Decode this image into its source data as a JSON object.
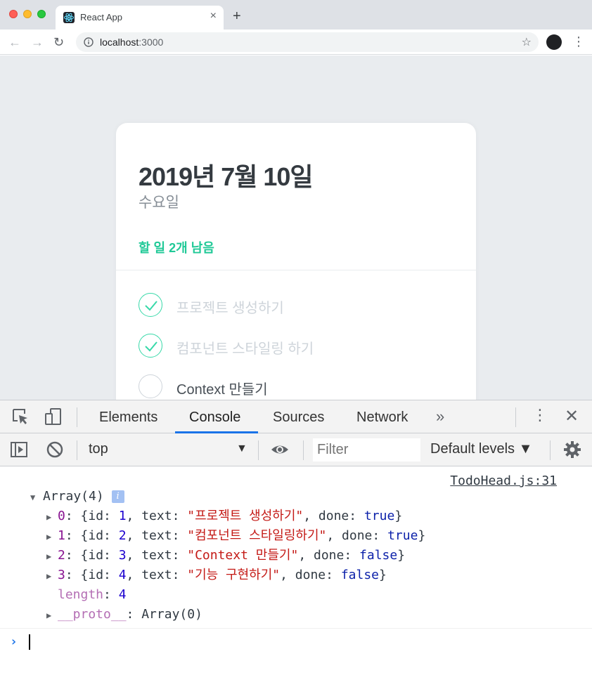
{
  "browser": {
    "tab_title": "React App",
    "tab_close": "×",
    "new_tab": "+",
    "url_host": "localhost",
    "url_port": ":3000",
    "back_icon": "←",
    "forward_icon": "→",
    "reload_icon": "↻",
    "star_icon": "☆",
    "menu_icon": "⋮"
  },
  "todo": {
    "date": "2019년 7월 10일",
    "day": "수요일",
    "tasks_left": "할 일 2개 남음",
    "items": [
      {
        "text": "프로젝트 생성하기",
        "done": true
      },
      {
        "text": "컴포넌트 스타일링 하기",
        "done": true
      },
      {
        "text": "Context 만들기",
        "done": false
      }
    ],
    "accent_color": "#20c997"
  },
  "devtools": {
    "tabs": [
      "Elements",
      "Console",
      "Sources",
      "Network"
    ],
    "active_tab": "Console",
    "more_tabs": "»",
    "kebab": "⋮",
    "close": "✕",
    "context": "top",
    "context_arrow": "▼",
    "filter_placeholder": "Filter",
    "levels": "Default levels ▼",
    "console": {
      "source": "TodoHead.js:31",
      "array_label": "Array(4)",
      "info": "i",
      "rows": [
        {
          "index": "0",
          "id": "1",
          "text": "\"프로젝트 생성하기\"",
          "done": "true"
        },
        {
          "index": "1",
          "id": "2",
          "text": "\"컴포넌트 스타일링하기\"",
          "done": "true"
        },
        {
          "index": "2",
          "id": "3",
          "text": "\"Context 만들기\"",
          "done": "false"
        },
        {
          "index": "3",
          "id": "4",
          "text": "\"기능 구현하기\"",
          "done": "false"
        }
      ],
      "length_key": "length",
      "length_val": "4",
      "proto_key": "__proto__",
      "proto_val": ": Array(0)",
      "prompt": "›"
    }
  }
}
